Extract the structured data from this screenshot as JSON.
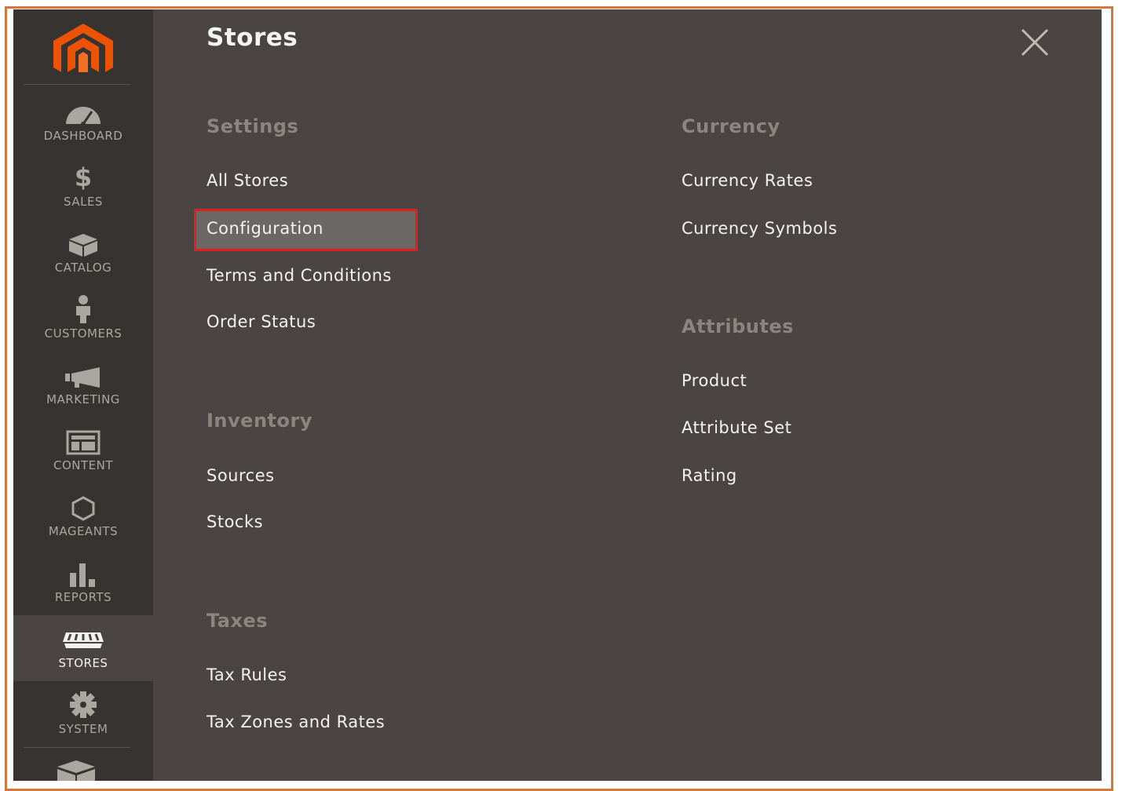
{
  "sidebar": {
    "items": [
      {
        "label": "DASHBOARD",
        "icon": "dashboard-icon"
      },
      {
        "label": "SALES",
        "icon": "dollar-icon"
      },
      {
        "label": "CATALOG",
        "icon": "box-icon"
      },
      {
        "label": "CUSTOMERS",
        "icon": "person-icon"
      },
      {
        "label": "MARKETING",
        "icon": "megaphone-icon"
      },
      {
        "label": "CONTENT",
        "icon": "layout-icon"
      },
      {
        "label": "MAGEANTS",
        "icon": "hexagon-icon"
      },
      {
        "label": "REPORTS",
        "icon": "bar-chart-icon"
      },
      {
        "label": "STORES",
        "icon": "storefront-icon",
        "active": true
      },
      {
        "label": "SYSTEM",
        "icon": "gear-icon"
      }
    ]
  },
  "panel": {
    "title": "Stores",
    "settings": {
      "title": "Settings",
      "links": [
        "All Stores",
        "Configuration",
        "Terms and Conditions",
        "Order Status"
      ]
    },
    "inventory": {
      "title": "Inventory",
      "links": [
        "Sources",
        "Stocks"
      ]
    },
    "taxes": {
      "title": "Taxes",
      "links": [
        "Tax Rules",
        "Tax Zones and Rates"
      ]
    },
    "currency": {
      "title": "Currency",
      "links": [
        "Currency Rates",
        "Currency Symbols"
      ]
    },
    "attributes": {
      "title": "Attributes",
      "links": [
        "Product",
        "Attribute Set",
        "Rating"
      ]
    }
  },
  "colors": {
    "accent": "#eb5202",
    "highlight_border": "#e0201f",
    "frame_border": "#d9773a"
  }
}
